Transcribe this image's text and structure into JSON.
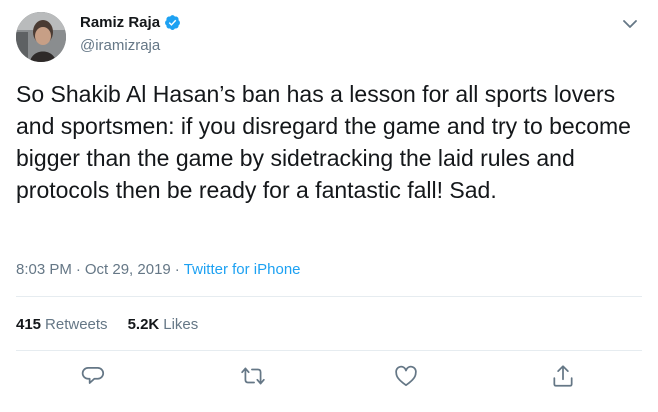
{
  "author": {
    "name": "Ramiz Raja",
    "handle": "@iramizraja",
    "verified": true
  },
  "tweet": {
    "text": "So Shakib Al Hasan’s ban has a lesson for all sports lovers and sportsmen: if you disregard the game and try to become bigger than the game by sidetracking the laid rules and protocols then be ready for a fantastic fall! Sad.",
    "time": "8:03 PM",
    "separator": "·",
    "date": "Oct 29, 2019",
    "source": "Twitter for iPhone"
  },
  "stats": {
    "retweets_count": "415",
    "retweets_label": "Retweets",
    "likes_count": "5.2K",
    "likes_label": "Likes"
  },
  "icons": {
    "verified": "verified-badge-icon",
    "caret": "chevron-down-icon",
    "reply": "reply-icon",
    "retweet": "retweet-icon",
    "like": "heart-icon",
    "share": "share-icon"
  },
  "colors": {
    "accent": "#1da1f2",
    "secondary_text": "#657786",
    "primary_text": "#14171a",
    "divider": "#e6ecf0"
  }
}
